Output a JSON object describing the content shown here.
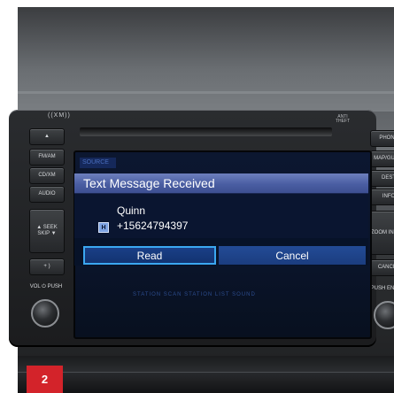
{
  "head_unit": {
    "brand": "((XM))",
    "anti_theft": "ANTI THEFT",
    "left_buttons": [
      {
        "label": "▲"
      },
      {
        "label": "FM/AM"
      },
      {
        "label": "CD/XM"
      },
      {
        "label": "AUDIO"
      },
      {
        "label": "▲ SEEK SKIP ▼"
      },
      {
        "label": "+ )"
      },
      {
        "label": "VOL ⏻ PUSH"
      }
    ],
    "right_buttons": [
      {
        "label": "PHONE"
      },
      {
        "label": "MAP/GUIDE"
      },
      {
        "label": "DEST"
      },
      {
        "label": "INFO"
      },
      {
        "label": "ZOOM IN OUT"
      },
      {
        "label": "CANCEL"
      },
      {
        "label": "PUSH ENTER"
      }
    ]
  },
  "screen": {
    "source_label": "SOURCE",
    "background_row": "STATION   SCAN   STATION LIST   SOUND"
  },
  "dialog": {
    "title": "Text Message Received",
    "contact_name": "Quinn",
    "contact_icon_letter": "H",
    "phone_number": "+15624794397",
    "read_label": "Read",
    "cancel_label": "Cancel"
  },
  "badge": {
    "step_number": "2",
    "color": "#d3232a"
  }
}
